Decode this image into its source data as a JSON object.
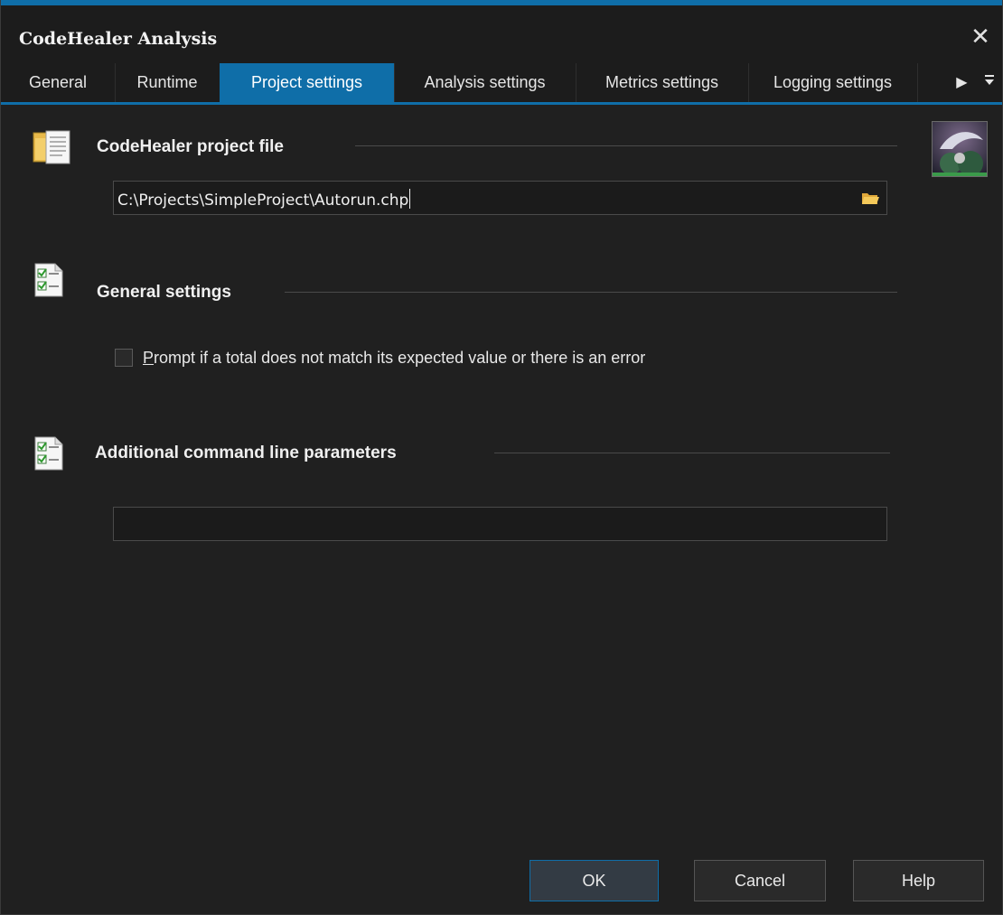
{
  "window": {
    "title": "CodeHealer Analysis",
    "close_icon": "close-icon"
  },
  "tabs": [
    {
      "label": "General"
    },
    {
      "label": "Runtime"
    },
    {
      "label": "Project settings",
      "active": true
    },
    {
      "label": "Analysis settings"
    },
    {
      "label": "Metrics settings"
    },
    {
      "label": "Logging settings"
    }
  ],
  "tab_nav": {
    "scroll_icon": "triangle-right-icon",
    "menu_icon": "overflow-menu-icon"
  },
  "project_file": {
    "heading": "CodeHealer project file",
    "icon": "folder-document-icon",
    "value": "C:\\Projects\\SimpleProject\\Autorun.chp",
    "browse_icon": "folder-open-icon"
  },
  "general_settings": {
    "heading": "General settings",
    "icon": "checklist-icon",
    "prompt_checkbox": {
      "label_accel": "P",
      "label_rest": "rompt if a total does not match its expected value or there is an error",
      "checked": false
    }
  },
  "command_line": {
    "heading": "Additional command line parameters",
    "icon": "checklist-icon",
    "value": ""
  },
  "buttons": {
    "ok": "OK",
    "cancel": "Cancel",
    "help": "Help"
  },
  "colors": {
    "accent": "#0f6ea8",
    "background": "#202020"
  }
}
